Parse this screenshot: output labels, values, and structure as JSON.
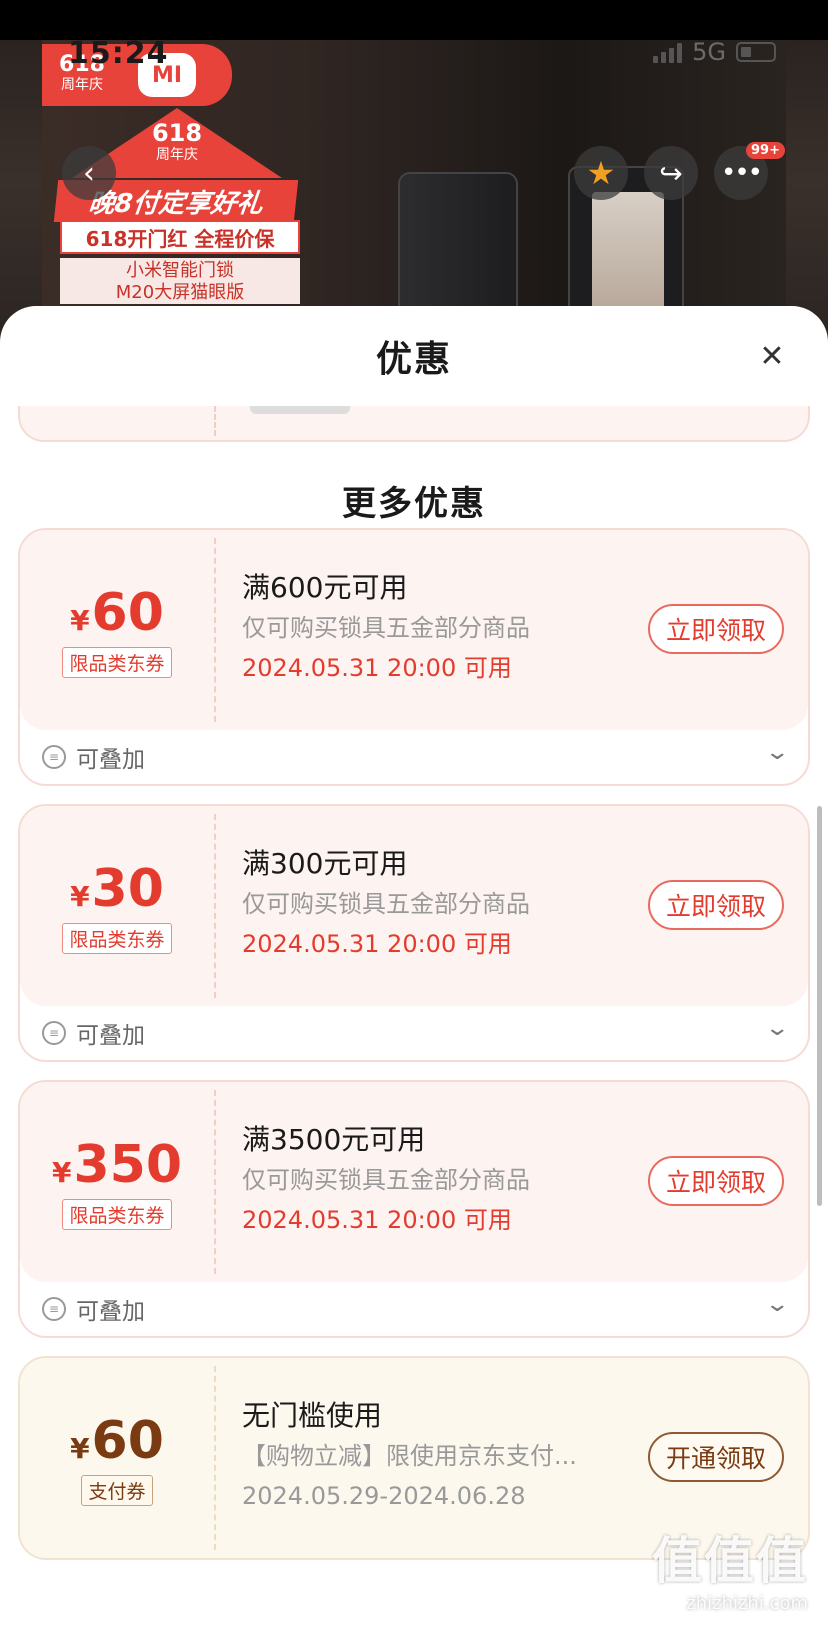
{
  "status_bar": {
    "time": "15:24",
    "network": "5G"
  },
  "product_bg": {
    "badge_618": "618",
    "badge_sub": "周年庆",
    "mi_logo": "MI",
    "house_618": "618",
    "house_sub": "周年庆",
    "promo_line1": "晚8付定享好礼",
    "promo_line2": "618开门红  全程价保",
    "promo_line3a": "小米智能门锁",
    "promo_line3b": "M20大屏猫眼版",
    "more_badge": "99+"
  },
  "icons": {
    "back": "chevron-left-icon",
    "favorite": "star-icon",
    "share": "share-icon",
    "more": "more-dots-icon",
    "close": "close-icon",
    "stack": "stack-icon",
    "expand": "chevron-down-icon"
  },
  "sheet": {
    "title": "优惠",
    "section_title": "更多优惠"
  },
  "coupons": [
    {
      "symbol": "¥",
      "amount": "60",
      "tag": "限品类东券",
      "condition": "满600元可用",
      "desc": "仅可购买锁具五金部分商品",
      "date": "2024.05.31 20:00 可用",
      "button": "立即领取",
      "footer": "可叠加"
    },
    {
      "symbol": "¥",
      "amount": "30",
      "tag": "限品类东券",
      "condition": "满300元可用",
      "desc": "仅可购买锁具五金部分商品",
      "date": "2024.05.31 20:00 可用",
      "button": "立即领取",
      "footer": "可叠加"
    },
    {
      "symbol": "¥",
      "amount": "350",
      "tag": "限品类东券",
      "condition": "满3500元可用",
      "desc": "仅可购买锁具五金部分商品",
      "date": "2024.05.31 20:00 可用",
      "button": "立即领取",
      "footer": "可叠加"
    },
    {
      "symbol": "¥",
      "amount": "60",
      "tag": "支付券",
      "condition": "无门槛使用",
      "desc": "【购物立减】限使用京东支付...",
      "date": "2024.05.29-2024.06.28",
      "button": "开通领取"
    }
  ],
  "colors": {
    "accent_red": "#e33c2f",
    "pay_brown": "#7a3b12",
    "card_bg_red": "#fdf3f0",
    "card_bg_gold": "#fdf8ee"
  },
  "watermark": {
    "logo": "值值值",
    "url": "zhizhizhi.com"
  }
}
